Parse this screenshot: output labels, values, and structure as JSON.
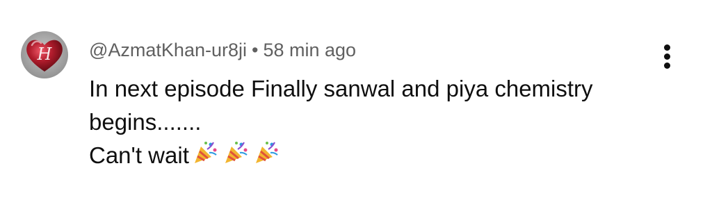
{
  "comment": {
    "author_handle": "@AzmatKhan-ur8ji",
    "separator": "•",
    "timestamp": "58 min ago",
    "text_lines": [
      "In next episode Finally sanwal and piya chemistry",
      "begins.......",
      "Can't wait"
    ],
    "reaction_emojis": [
      "party-popper-icon",
      "party-popper-icon",
      "party-popper-icon"
    ],
    "avatar_letter": "H",
    "more_menu_icon": "vertical-ellipsis-icon"
  },
  "colors": {
    "meta_text": "#606060",
    "body_text": "#0f0f0f",
    "avatar_red": "#8b1420"
  }
}
